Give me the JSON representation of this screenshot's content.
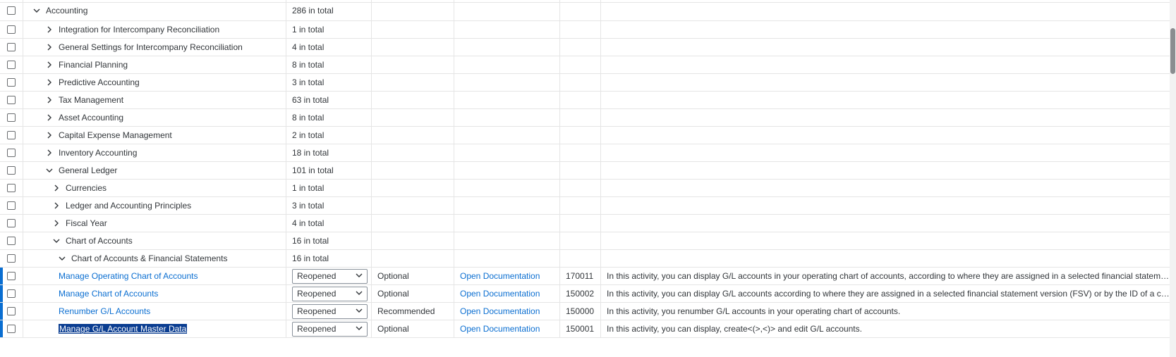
{
  "rows": [
    {
      "indent": 0,
      "expanded": true,
      "name": "Accounting",
      "count": "286 in total"
    },
    {
      "indent": 1,
      "expanded": false,
      "name": "Integration for Intercompany Reconciliation",
      "count": "1 in total"
    },
    {
      "indent": 1,
      "expanded": false,
      "name": "General Settings for Intercompany Reconciliation",
      "count": "4 in total"
    },
    {
      "indent": 1,
      "expanded": false,
      "name": "Financial Planning",
      "count": "8 in total"
    },
    {
      "indent": 1,
      "expanded": false,
      "name": "Predictive Accounting",
      "count": "3 in total"
    },
    {
      "indent": 1,
      "expanded": false,
      "name": "Tax Management",
      "count": "63 in total"
    },
    {
      "indent": 1,
      "expanded": false,
      "name": "Asset Accounting",
      "count": "8 in total"
    },
    {
      "indent": 1,
      "expanded": false,
      "name": "Capital Expense Management",
      "count": "2 in total"
    },
    {
      "indent": 1,
      "expanded": false,
      "name": "Inventory Accounting",
      "count": "18 in total"
    },
    {
      "indent": 1,
      "expanded": true,
      "name": "General Ledger",
      "count": "101 in total"
    },
    {
      "indent": 2,
      "expanded": false,
      "name": "Currencies",
      "count": "1 in total"
    },
    {
      "indent": 2,
      "expanded": false,
      "name": "Ledger and Accounting Principles",
      "count": "3 in total"
    },
    {
      "indent": 2,
      "expanded": false,
      "name": "Fiscal Year",
      "count": "4 in total"
    },
    {
      "indent": 2,
      "expanded": true,
      "name": "Chart of Accounts",
      "count": "16 in total"
    },
    {
      "indent": 3,
      "expanded": true,
      "name": "Chart of Accounts & Financial Statements",
      "count": "16 in total"
    }
  ],
  "activities": [
    {
      "name": "Manage Operating Chart of Accounts",
      "status": "Reopened",
      "relevance": "Optional",
      "doc": "Open Documentation",
      "id": "170011",
      "desc": "In this activity, you can display G/L accounts in your operating chart of accounts, according to where they are assigned in a selected financial statement version (FSV)."
    },
    {
      "name": "Manage Chart of Accounts",
      "status": "Reopened",
      "relevance": "Optional",
      "doc": "Open Documentation",
      "id": "150002",
      "desc": "In this activity, you can display G/L accounts according to where they are assigned in a selected financial statement version (FSV) or by the ID of a chart of accounts."
    },
    {
      "name": "Renumber G/L Accounts",
      "status": "Reopened",
      "relevance": "Recommended",
      "doc": "Open Documentation",
      "id": "150000",
      "desc": "In this activity, you renumber G/L accounts in your operating chart of accounts."
    },
    {
      "name": "Manage G/L Account Master Data",
      "status": "Reopened",
      "relevance": "Optional",
      "doc": "Open Documentation",
      "id": "150001",
      "desc": "In this activity, you can display, create<(>,<)> and edit G/L accounts.",
      "selected": true
    }
  ],
  "icons": {
    "expand": "chevron-right-icon",
    "collapse": "chevron-down-icon",
    "dropdown": "chevron-down-icon"
  },
  "colors": {
    "link": "#0a6ed1",
    "row_marker": "#0a6ed1",
    "selection": "#0a3d91"
  }
}
